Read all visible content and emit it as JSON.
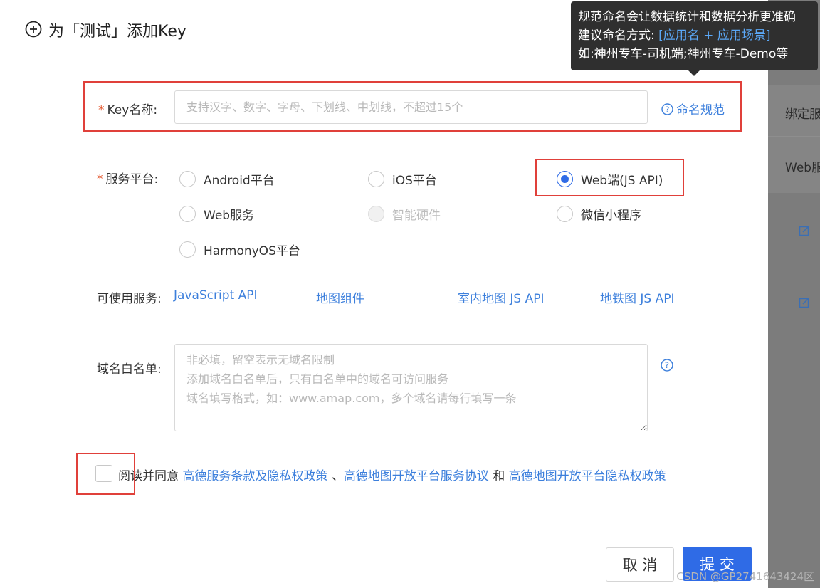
{
  "modal": {
    "title": "为「测试」添加Key"
  },
  "tooltip": {
    "line1": "规范命名会让数据统计和数据分析更准确",
    "line2_prefix": "建议命名方式: ",
    "line2_highlight": "[应用名 + 应用场景]",
    "line3": "如:神州专车-司机端;神州专车-Demo等"
  },
  "key_name": {
    "label": "Key名称:",
    "required_mark": "*",
    "placeholder": "支持汉字、数字、字母、下划线、中划线，不超过15个",
    "value": "",
    "help_link": "命名规范"
  },
  "platform": {
    "label": "服务平台:",
    "required_mark": "*",
    "options": [
      {
        "label": "Android平台",
        "checked": false,
        "disabled": false
      },
      {
        "label": "iOS平台",
        "checked": false,
        "disabled": false
      },
      {
        "label": "Web端(JS API)",
        "checked": true,
        "disabled": false
      },
      {
        "label": "Web服务",
        "checked": false,
        "disabled": false
      },
      {
        "label": "智能硬件",
        "checked": false,
        "disabled": true
      },
      {
        "label": "微信小程序",
        "checked": false,
        "disabled": false
      },
      {
        "label": "HarmonyOS平台",
        "checked": false,
        "disabled": false
      }
    ]
  },
  "services": {
    "label": "可使用服务:",
    "items": [
      "JavaScript API",
      "地图组件",
      "室内地图 JS API",
      "地铁图 JS API"
    ]
  },
  "domain_whitelist": {
    "label": "域名白名单:",
    "placeholder": "非必填，留空表示无域名限制\n添加域名白名单后，只有白名单中的域名可访问服务\n域名填写格式，如：www.amap.com，多个域名请每行填写一条",
    "value": ""
  },
  "agreement": {
    "checked": false,
    "prefix": "阅读并同意",
    "link1": "高德服务条款及隐私权政策",
    "sep1": "、",
    "link2": "高德地图开放平台服务协议",
    "sep2": "和",
    "link3": "高德地图开放平台隐私权政策"
  },
  "footer": {
    "cancel_label": "取 消",
    "submit_label": "提 交"
  },
  "background_page": {
    "row1": "绑定服",
    "row2": "Web服"
  },
  "watermark": "CSDN @GP2741643424区",
  "colors": {
    "primary": "#2f6be6",
    "link": "#3c7fdc",
    "required": "#e4572e",
    "annotation": "#e0403a",
    "tooltip_bg": "#2f2f2f"
  }
}
